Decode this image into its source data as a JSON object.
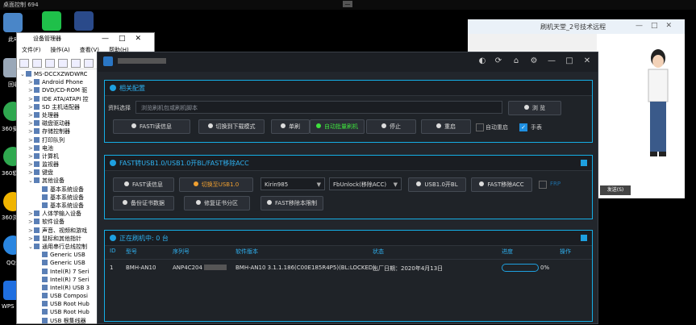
{
  "remote_bar": {
    "title": "桌面控制 694",
    "minimize_label": "—"
  },
  "desktop": {
    "icons": [
      {
        "label": "此电",
        "color": "#4a86c8"
      },
      {
        "label": "回收",
        "color": "#9aa8b8"
      },
      {
        "label": "360安",
        "color": "#2fa84f"
      },
      {
        "label": "360软",
        "color": "#2fa84f"
      },
      {
        "label": "360浏",
        "color": "#f0b400"
      },
      {
        "label": "QQ浏",
        "color": "#2a86e0"
      },
      {
        "label": "WPS Of",
        "color": "#1f6fe0"
      }
    ]
  },
  "device_manager": {
    "title": "设备管理器",
    "menu": [
      "文件(F)",
      "操作(A)",
      "查看(V)",
      "帮助(H)"
    ],
    "tree": [
      {
        "label": "MS-DCCXZWDWRC",
        "indent": 0,
        "exp": "⌄"
      },
      {
        "label": "Android Phone",
        "indent": 1,
        "exp": ">"
      },
      {
        "label": "DVD/CD-ROM 驱",
        "indent": 1,
        "exp": ">"
      },
      {
        "label": "IDE ATA/ATAPI 控",
        "indent": 1,
        "exp": ">"
      },
      {
        "label": "SD 主机适配器",
        "indent": 1,
        "exp": ">"
      },
      {
        "label": "处理器",
        "indent": 1,
        "exp": ">"
      },
      {
        "label": "磁盘驱动器",
        "indent": 1,
        "exp": ">"
      },
      {
        "label": "存储控制器",
        "indent": 1,
        "exp": ">"
      },
      {
        "label": "打印队列",
        "indent": 1,
        "exp": ">"
      },
      {
        "label": "电池",
        "indent": 1,
        "exp": ">"
      },
      {
        "label": "计算机",
        "indent": 1,
        "exp": ">"
      },
      {
        "label": "监视器",
        "indent": 1,
        "exp": ">"
      },
      {
        "label": "键盘",
        "indent": 1,
        "exp": ">"
      },
      {
        "label": "其他设备",
        "indent": 1,
        "exp": "⌄"
      },
      {
        "label": "基本系统设备",
        "indent": 2,
        "exp": ""
      },
      {
        "label": "基本系统设备",
        "indent": 2,
        "exp": ""
      },
      {
        "label": "基本系统设备",
        "indent": 2,
        "exp": ""
      },
      {
        "label": "人体学输入设备",
        "indent": 1,
        "exp": ">"
      },
      {
        "label": "软件设备",
        "indent": 1,
        "exp": ">"
      },
      {
        "label": "声音、视频和游戏",
        "indent": 1,
        "exp": ">"
      },
      {
        "label": "鼠标和其他指针",
        "indent": 1,
        "exp": ">"
      },
      {
        "label": "通用串行总线控制",
        "indent": 1,
        "exp": "⌄"
      },
      {
        "label": "Generic USB",
        "indent": 2,
        "exp": ""
      },
      {
        "label": "Generic USB",
        "indent": 2,
        "exp": ""
      },
      {
        "label": "Intel(R) 7 Seri",
        "indent": 2,
        "exp": ""
      },
      {
        "label": "Intel(R) 7 Seri",
        "indent": 2,
        "exp": ""
      },
      {
        "label": "Intel(R) USB 3",
        "indent": 2,
        "exp": ""
      },
      {
        "label": "USB Composi",
        "indent": 2,
        "exp": ""
      },
      {
        "label": "USB Root Hub",
        "indent": 2,
        "exp": ""
      },
      {
        "label": "USB Root Hub",
        "indent": 2,
        "exp": ""
      },
      {
        "label": "USB 根集线器",
        "indent": 2,
        "exp": ""
      }
    ]
  },
  "chat": {
    "title": "刷机天堂_2号技术远程",
    "send_label": "发送(S)"
  },
  "tool": {
    "section1": {
      "title": "相关配置",
      "file_label": "资料选择",
      "file_placeholder": "浏览刷机包或刷机脚本",
      "browse_label": "浏 览",
      "buttons": [
        "FASTI读信息",
        "切换到下载模式",
        "单刷",
        "自动批量刷机",
        "停止",
        "重启"
      ],
      "auto_reboot_label": "自动重启",
      "manual_label": "手表"
    },
    "section2": {
      "title": "FAST转USB1.0/USB1.0开BL/FAST移除ACC",
      "buttons": [
        "FAST读信息",
        "切换至USB1.0",
        "USB1.0开BL",
        "FAST移除ACC",
        "备份证书数据",
        "修复证书分区",
        "FAST移除本限制"
      ],
      "chip_select": "Kirin985",
      "method_select": "FbUnlock(移除ACC)",
      "frp_label": "FRP"
    },
    "section3": {
      "title": "正在刷机中: 0 台",
      "headers": [
        "ID",
        "型号",
        "序列号",
        "软件版本",
        "状态",
        "进度",
        "操作"
      ],
      "rows": [
        {
          "id": "1",
          "model": "BMH-AN10",
          "serial": "ANP4C204",
          "version": "BMH-AN10 3.1.1.186(C00E185R4P5)(BL:LOCKED)",
          "status": "出厂日期：2020年4月13日",
          "progress_text": "0%",
          "progress": 0.0
        }
      ]
    }
  }
}
